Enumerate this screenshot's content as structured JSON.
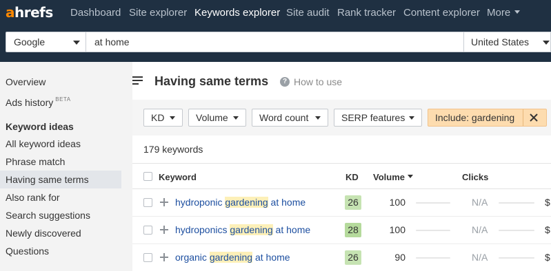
{
  "brand": {
    "logo_a": "a",
    "logo_rest": "hrefs",
    "accent": "#ff8800",
    "nav_bg": "#1f3042"
  },
  "nav": {
    "items": [
      "Dashboard",
      "Site explorer",
      "Keywords explorer",
      "Site audit",
      "Rank tracker",
      "Content explorer"
    ],
    "more": "More",
    "active": "Keywords explorer"
  },
  "search": {
    "engine": "Google",
    "query": "at home",
    "country": "United States"
  },
  "sidebar": {
    "overview": "Overview",
    "ads_history": "Ads history",
    "beta": "BETA",
    "heading": "Keyword ideas",
    "items": [
      "All keyword ideas",
      "Phrase match",
      "Having same terms",
      "Also rank for",
      "Search suggestions",
      "Newly discovered",
      "Questions"
    ],
    "active": "Having same terms"
  },
  "main": {
    "title": "Having same terms",
    "help": "How to use",
    "filters": [
      "KD",
      "Volume",
      "Word count",
      "SERP features"
    ],
    "include": "Include: gardening",
    "count": "179 keywords",
    "columns": {
      "keyword": "Keyword",
      "kd": "KD",
      "volume": "Volume",
      "clicks": "Clicks"
    },
    "rows": [
      {
        "pre": "hydroponic ",
        "hl": "gardening",
        "post": " at home",
        "kd": "26",
        "kd_color": "#c6e3b2",
        "volume": "100",
        "clicks": "N/A",
        "cps": "$"
      },
      {
        "pre": "hydroponics ",
        "hl": "gardening",
        "post": " at home",
        "kd": "28",
        "kd_color": "#b5da9c",
        "volume": "100",
        "clicks": "N/A",
        "cps": "$"
      },
      {
        "pre": "organic ",
        "hl": "gardening",
        "post": " at home",
        "kd": "26",
        "kd_color": "#c6e3b2",
        "volume": "90",
        "clicks": "N/A",
        "cps": "$"
      }
    ]
  }
}
